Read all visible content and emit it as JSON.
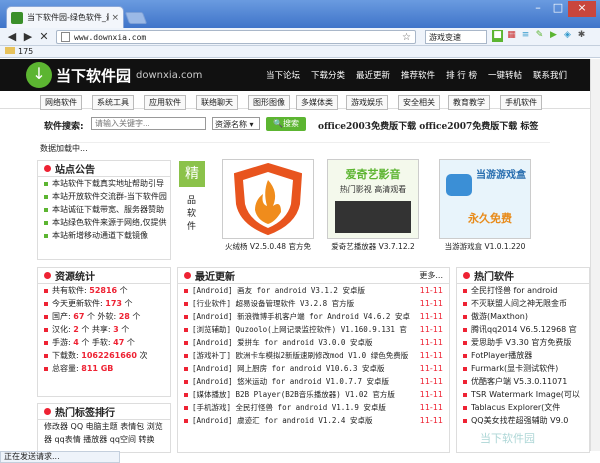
{
  "browser": {
    "tab_title": "当下软件园-绿色软件_最",
    "url": "www.downxia.com",
    "mode_label": "游戏变速",
    "bookmark": "175",
    "status": "正在发送请求..."
  },
  "header": {
    "logo_name": "当下软件园",
    "logo_domain": "downxia.com",
    "nav": [
      "当下论坛",
      "下载分类",
      "最近更新",
      "推荐软件",
      "排 行 榜",
      "一键转帖",
      "联系我们"
    ]
  },
  "categories": [
    "网络软件",
    "系统工具",
    "应用软件",
    "联络聊天",
    "图形图像",
    "多媒体类",
    "游戏娱乐",
    "安全相关",
    "教育教学",
    "手机软件"
  ],
  "search": {
    "label": "软件搜索:",
    "placeholder": "请输入关键字...",
    "select": "资源名称",
    "button": "搜索",
    "hot": "office2003免费版下载  office2007免费版下载   标签"
  },
  "loading": "数据加载中...",
  "notice": {
    "title": "站点公告",
    "items": [
      "本站软件下载真实地址帮助引导",
      "本站开放软件交流群-当下软件园",
      "本站诚征下载带宽、服务器赞助",
      "本站绿色软件来源于网络,仅提供",
      "本站新增移动通道下载镜像"
    ]
  },
  "featured": {
    "label": "精",
    "vertical": "品软件",
    "cards": [
      {
        "caption": "火绒杨  V2.5.0.48 官方免"
      },
      {
        "caption": "爱奇艺播放器 V3.7.12.2"
      },
      {
        "caption": "当游游戏盒 V1.0.1.220"
      }
    ],
    "card2_title": "爱奇艺影音",
    "card2_sub": "热门影视 高清观看",
    "card3_title": "当游游戏盒",
    "card3_sub": "永久免费"
  },
  "stats": {
    "title": "资源统计",
    "rows": [
      {
        "label": "共有软件:",
        "value": "52816",
        "unit": "个"
      },
      {
        "label": "今天更新软件:",
        "value": "173",
        "unit": "个"
      },
      {
        "label": "国产:",
        "value": "67",
        "unit": "个 外软:",
        "value2": "28",
        "unit2": "个"
      },
      {
        "label": "汉化:",
        "value": "2",
        "unit": "个 共享:",
        "value2": "3",
        "unit2": "个"
      },
      {
        "label": "手游:",
        "value": "4",
        "unit": "个 手软:",
        "value2": "47",
        "unit2": "个"
      },
      {
        "label": "下载数:",
        "value": "1062261660",
        "unit": "次"
      },
      {
        "label": "总容量:",
        "value": "811 GB",
        "unit": ""
      }
    ]
  },
  "latest": {
    "title": "最近更新",
    "more": "更多...",
    "items": [
      {
        "t": "[Android] 画友 for android V3.1.2 安卓版",
        "d": "11-11"
      },
      {
        "t": "[行业软件] 超易设备管理软件 V3.2.8 官方版",
        "d": "11-11"
      },
      {
        "t": "[Android] 新浪微博手机客户端 for Android V4.6.2 安卓",
        "d": "11-11"
      },
      {
        "t": "[浏览辅助] Quzoolo(上网记录监控软件) V1.160.9.131 官",
        "d": "11-11"
      },
      {
        "t": "[Android] 爱拼车 for android V3.0.0 安卓版",
        "d": "11-11"
      },
      {
        "t": "[游戏补丁] 欧洲卡车模拟2新版速刷修改mod V1.0 绿色免费版",
        "d": "11-11"
      },
      {
        "t": "[Android] 网上厨房 for android V10.6.3 安卓版",
        "d": "11-11"
      },
      {
        "t": "[Android] 悠米运动 for android V1.0.7.7 安卓版",
        "d": "11-11"
      },
      {
        "t": "[媒体播放] B2B Player(B2B音乐播放器) V1.02 官方版",
        "d": "11-11"
      },
      {
        "t": "[手机游戏] 全民打怪兽 for android V1.1.9 安卓版",
        "d": "11-11"
      },
      {
        "t": "[Android] 虞迹汇 for android V1.2.4 安卓版",
        "d": "11-11"
      }
    ]
  },
  "hot": {
    "title": "热门软件",
    "items": [
      "全民打怪兽 for android",
      "不灭联盟人间之神无限金币",
      "傲游(Maxthon)",
      "腾讯qq2014 V6.5.12968 官",
      "爱思助手 V3.30 官方免费版",
      "FotPlayer播放器",
      "Furmark(显卡测试软件)",
      "优酷客户端 V5.3.0.11071",
      "TSR Watermark Image(可以",
      "Tablacus Explorer(文件",
      "QQ美女找茬超强辅助 V9.0"
    ]
  },
  "tags": {
    "title": "热门标签排行",
    "lines": [
      "修改器 QQ 电脑主题 表情包 浏览",
      "器 qq表情 播放器 qq空间 转换"
    ]
  },
  "watermark": "当下软件园"
}
